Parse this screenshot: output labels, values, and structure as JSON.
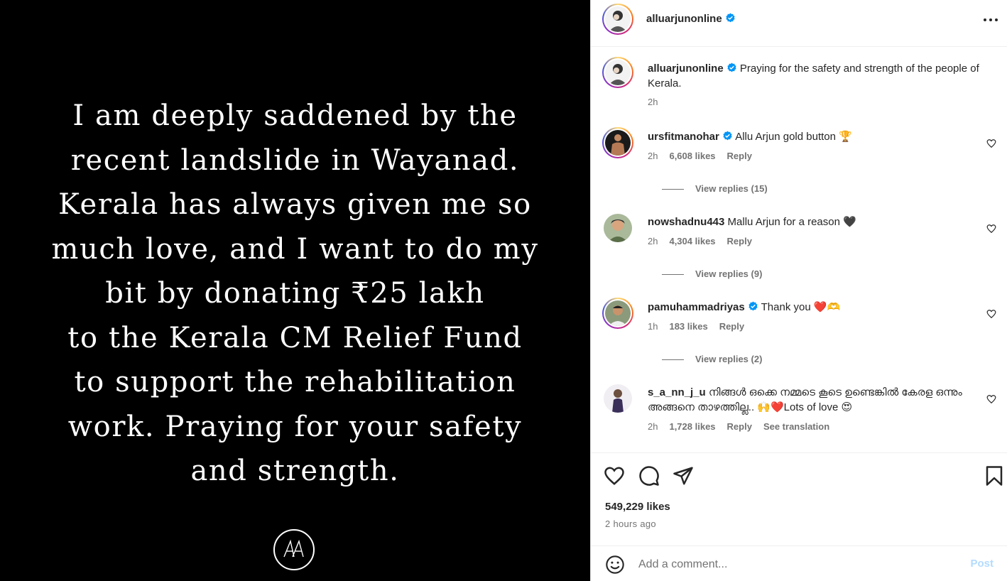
{
  "media": {
    "text": "I am deeply saddened by the\nrecent landslide in Wayanad.\nKerala has always given me so\nmuch love, and I want to do my\nbit by donating ₹25 lakh\nto the Kerala CM Relief Fund\nto support the rehabilitation\nwork. Praying for your safety\nand strength."
  },
  "header": {
    "username": "alluarjunonline",
    "verified": true
  },
  "caption": {
    "username": "alluarjunonline",
    "text": "Praying for the safety and strength of the people of Kerala.",
    "time": "2h"
  },
  "comments": [
    {
      "username": "ursfitmanohar",
      "verified": true,
      "text": "Allu Arjun gold button 🏆",
      "time": "2h",
      "likes": "6,608 likes",
      "reply": "Reply",
      "view_replies": "View replies (15)"
    },
    {
      "username": "nowshadnu443",
      "verified": false,
      "text": "Mallu Arjun for a reason 🖤",
      "time": "2h",
      "likes": "4,304 likes",
      "reply": "Reply",
      "view_replies": "View replies (9)"
    },
    {
      "username": "pamuhammadriyas",
      "verified": true,
      "text": "Thank you ❤️🫶",
      "time": "1h",
      "likes": "183 likes",
      "reply": "Reply",
      "view_replies": "View replies (2)"
    },
    {
      "username": "s_a_nn_j_u",
      "verified": false,
      "text": "നിങ്ങൾ ഒക്കെ നമ്മടെ കൂടെ ഉണ്ടെങ്കിൽ കേരള ഒന്നും അങ്ങനെ താഴത്തില്ല.. 🙌❤️Lots of love 😍",
      "time": "2h",
      "likes": "1,728 likes",
      "reply": "Reply",
      "translate": "See translation"
    }
  ],
  "actions": {
    "likes": "549,229 likes",
    "posted": "2 hours ago"
  },
  "add_comment": {
    "placeholder": "Add a comment...",
    "post_label": "Post"
  },
  "colors": {
    "verified": "#0095f6",
    "muted": "#737373",
    "post_disabled": "#b3dbff"
  }
}
